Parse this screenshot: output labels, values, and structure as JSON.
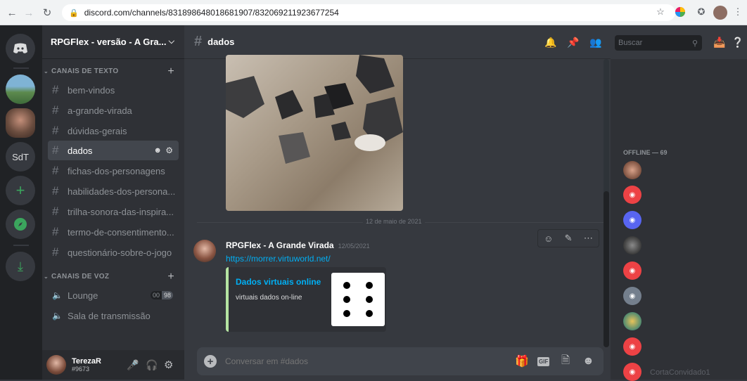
{
  "browser": {
    "url": "discord.com/channels/831898648018681907/832069211923677254"
  },
  "servers": {
    "sdt_label": "SdT"
  },
  "guild": {
    "name": "RPGFlex - versão - A Gra...",
    "text_category": "CANAIS DE TEXTO",
    "voice_category": "CANAIS DE VOZ",
    "text_channels": [
      "bem-vindos",
      "a-grande-virada",
      "dúvidas-gerais",
      "dados",
      "fichas-dos-personagens",
      "habilidades-dos-persona...",
      "trilha-sonora-das-inspira...",
      "termo-de-consentimento...",
      "questionário-sobre-o-jogo"
    ],
    "voice_channels": [
      "Lounge",
      "Sala de transmissão"
    ],
    "lounge_counts": [
      "00",
      "98"
    ]
  },
  "user": {
    "name": "TerezaR",
    "tag": "#9673"
  },
  "chat": {
    "channel_name": "dados",
    "date_divider": "12 de maio de 2021",
    "message": {
      "author": "RPGFlex - A Grande Virada",
      "timestamp": "12/05/2021",
      "link": "https://morrer.virtuworld.net/",
      "embed_title": "Dados virtuais online",
      "embed_desc": "virtuais dados on-line"
    },
    "input_placeholder": "Conversar em #dados"
  },
  "header": {
    "search_placeholder": "Buscar"
  },
  "members": {
    "offline_header": "OFFLINE — 69",
    "last_member": "CortaConvidado1"
  },
  "colors": {
    "blurple": "#5865f2",
    "green": "#3ba55d",
    "red": "#ed4245",
    "link": "#00aff4"
  }
}
